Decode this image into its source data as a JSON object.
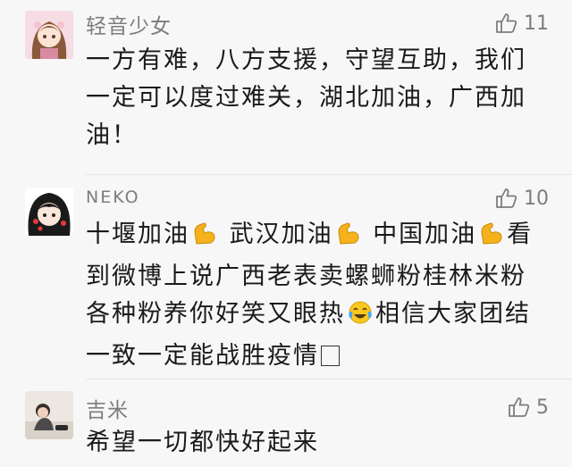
{
  "comments": [
    {
      "user": "轻音少女",
      "likes": "11",
      "text": "一方有难，八方支援，守望互助，我们一定可以度过难关，湖北加油，广西加油！"
    },
    {
      "user": "NEKO",
      "likes": "10",
      "text_parts": [
        "十堰加油",
        "武汉加油",
        "中国加油",
        "看到微博上说广西老表卖螺蛳粉桂林米粉各种粉养你好笑又眼热",
        "相信大家团结一致一定能战胜疫情"
      ],
      "icons": [
        "flexed-biceps-emoji",
        "flexed-biceps-emoji",
        "flexed-biceps-emoji",
        "crying-laughing-emoji",
        "missing-glyph-box"
      ]
    },
    {
      "user": "吉米",
      "likes": "5",
      "text": "希望一切都快好起来"
    }
  ],
  "colors": {
    "background": "#f7f7f7",
    "username": "#7d7d7d",
    "body_text": "#1a1a1a",
    "emoji_yellow": "#f5b21a"
  }
}
